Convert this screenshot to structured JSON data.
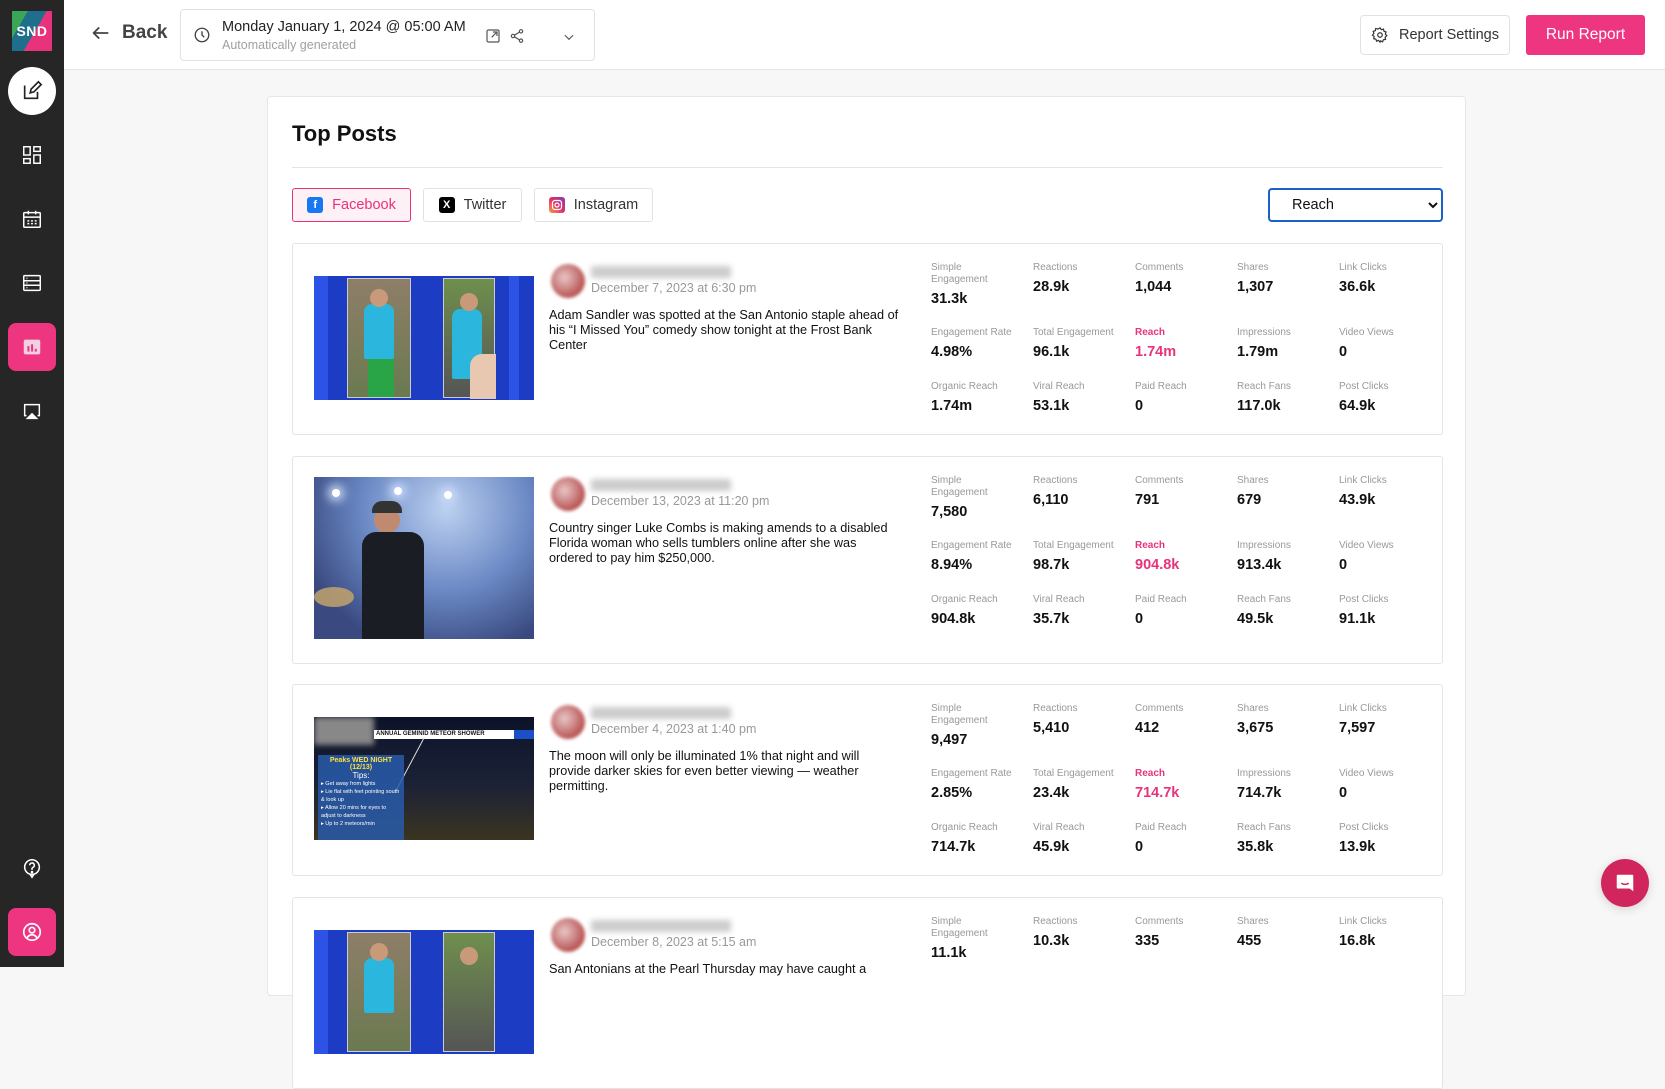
{
  "app": {
    "logo_text": "SND",
    "accent_color": "#ee3580"
  },
  "sidebar": {
    "items": [
      {
        "name": "compose",
        "icon": "edit-icon"
      },
      {
        "name": "dashboard",
        "icon": "dashboard-icon"
      },
      {
        "name": "calendar",
        "icon": "calendar-icon"
      },
      {
        "name": "list",
        "icon": "list-icon"
      },
      {
        "name": "reports",
        "icon": "bar-chart-icon",
        "active": true
      },
      {
        "name": "broadcast",
        "icon": "airplay-icon"
      },
      {
        "name": "help",
        "icon": "help-icon"
      },
      {
        "name": "account",
        "icon": "user-circle-icon"
      }
    ]
  },
  "header": {
    "back_label": "Back",
    "report_date": "Monday January 1, 2024 @ 05:00 AM",
    "report_subtitle": "Automatically generated",
    "report_settings_label": "Report Settings",
    "run_report_label": "Run Report"
  },
  "top_posts": {
    "title": "Top Posts",
    "tabs": [
      {
        "label": "Facebook",
        "icon": "facebook-icon",
        "active": true
      },
      {
        "label": "Twitter",
        "icon": "x-twitter-icon",
        "active": false
      },
      {
        "label": "Instagram",
        "icon": "instagram-icon",
        "active": false
      }
    ],
    "metric_select": {
      "selected": "Reach"
    },
    "posts": [
      {
        "date": "December 7, 2023 at 6:30 pm",
        "text": "Adam Sandler was spotted at the San Antonio staple ahead of his “I Missed You” comedy show tonight at the Frost Bank Center",
        "stats": [
          {
            "label": "Simple Engagement",
            "value": "31.3k"
          },
          {
            "label": "Reactions",
            "value": "28.9k"
          },
          {
            "label": "Comments",
            "value": "1,044"
          },
          {
            "label": "Shares",
            "value": "1,307"
          },
          {
            "label": "Link Clicks",
            "value": "36.6k"
          },
          {
            "label": "Engagement Rate",
            "value": "4.98%"
          },
          {
            "label": "Total Engagement",
            "value": "96.1k"
          },
          {
            "label": "Reach",
            "value": "1.74m",
            "highlight": true
          },
          {
            "label": "Impressions",
            "value": "1.79m"
          },
          {
            "label": "Video Views",
            "value": "0"
          },
          {
            "label": "Organic Reach",
            "value": "1.74m"
          },
          {
            "label": "Viral Reach",
            "value": "53.1k"
          },
          {
            "label": "Paid Reach",
            "value": "0"
          },
          {
            "label": "Reach Fans",
            "value": "117.0k"
          },
          {
            "label": "Post Clicks",
            "value": "64.9k"
          }
        ]
      },
      {
        "date": "December 13, 2023 at 11:20 pm",
        "text": "Country singer Luke Combs is making amends to a disabled Florida woman who sells tumblers online after she was ordered to pay him $250,000.",
        "stats": [
          {
            "label": "Simple Engagement",
            "value": "7,580"
          },
          {
            "label": "Reactions",
            "value": "6,110"
          },
          {
            "label": "Comments",
            "value": "791"
          },
          {
            "label": "Shares",
            "value": "679"
          },
          {
            "label": "Link Clicks",
            "value": "43.9k"
          },
          {
            "label": "Engagement Rate",
            "value": "8.94%"
          },
          {
            "label": "Total Engagement",
            "value": "98.7k"
          },
          {
            "label": "Reach",
            "value": "904.8k",
            "highlight": true
          },
          {
            "label": "Impressions",
            "value": "913.4k"
          },
          {
            "label": "Video Views",
            "value": "0"
          },
          {
            "label": "Organic Reach",
            "value": "904.8k"
          },
          {
            "label": "Viral Reach",
            "value": "35.7k"
          },
          {
            "label": "Paid Reach",
            "value": "0"
          },
          {
            "label": "Reach Fans",
            "value": "49.5k"
          },
          {
            "label": "Post Clicks",
            "value": "91.1k"
          }
        ]
      },
      {
        "date": "December 4, 2023 at 1:40 pm",
        "text": "The moon will only be illuminated 1% that night and will provide darker skies for even better viewing — weather permitting.",
        "image_text": {
          "banner": "ANNUAL GEMINID METEOR SHOWER",
          "heading": "Peaks WED NIGHT (12/13)",
          "tips_title": "Tips:",
          "tips": [
            "Get away from lights",
            "Lie flat with feet pointing south & look up",
            "Allow 20 mins for eyes to adjust to darkness",
            "Up to 2 meteors/min"
          ]
        },
        "stats": [
          {
            "label": "Simple Engagement",
            "value": "9,497"
          },
          {
            "label": "Reactions",
            "value": "5,410"
          },
          {
            "label": "Comments",
            "value": "412"
          },
          {
            "label": "Shares",
            "value": "3,675"
          },
          {
            "label": "Link Clicks",
            "value": "7,597"
          },
          {
            "label": "Engagement Rate",
            "value": "2.85%"
          },
          {
            "label": "Total Engagement",
            "value": "23.4k"
          },
          {
            "label": "Reach",
            "value": "714.7k",
            "highlight": true
          },
          {
            "label": "Impressions",
            "value": "714.7k"
          },
          {
            "label": "Video Views",
            "value": "0"
          },
          {
            "label": "Organic Reach",
            "value": "714.7k"
          },
          {
            "label": "Viral Reach",
            "value": "45.9k"
          },
          {
            "label": "Paid Reach",
            "value": "0"
          },
          {
            "label": "Reach Fans",
            "value": "35.8k"
          },
          {
            "label": "Post Clicks",
            "value": "13.9k"
          }
        ]
      },
      {
        "date": "December 8, 2023 at 5:15 am",
        "text": "San Antonians at the Pearl Thursday may have caught a",
        "stats": [
          {
            "label": "Simple Engagement",
            "value": "11.1k"
          },
          {
            "label": "Reactions",
            "value": "10.3k"
          },
          {
            "label": "Comments",
            "value": "335"
          },
          {
            "label": "Shares",
            "value": "455"
          },
          {
            "label": "Link Clicks",
            "value": "16.8k"
          }
        ]
      }
    ]
  }
}
